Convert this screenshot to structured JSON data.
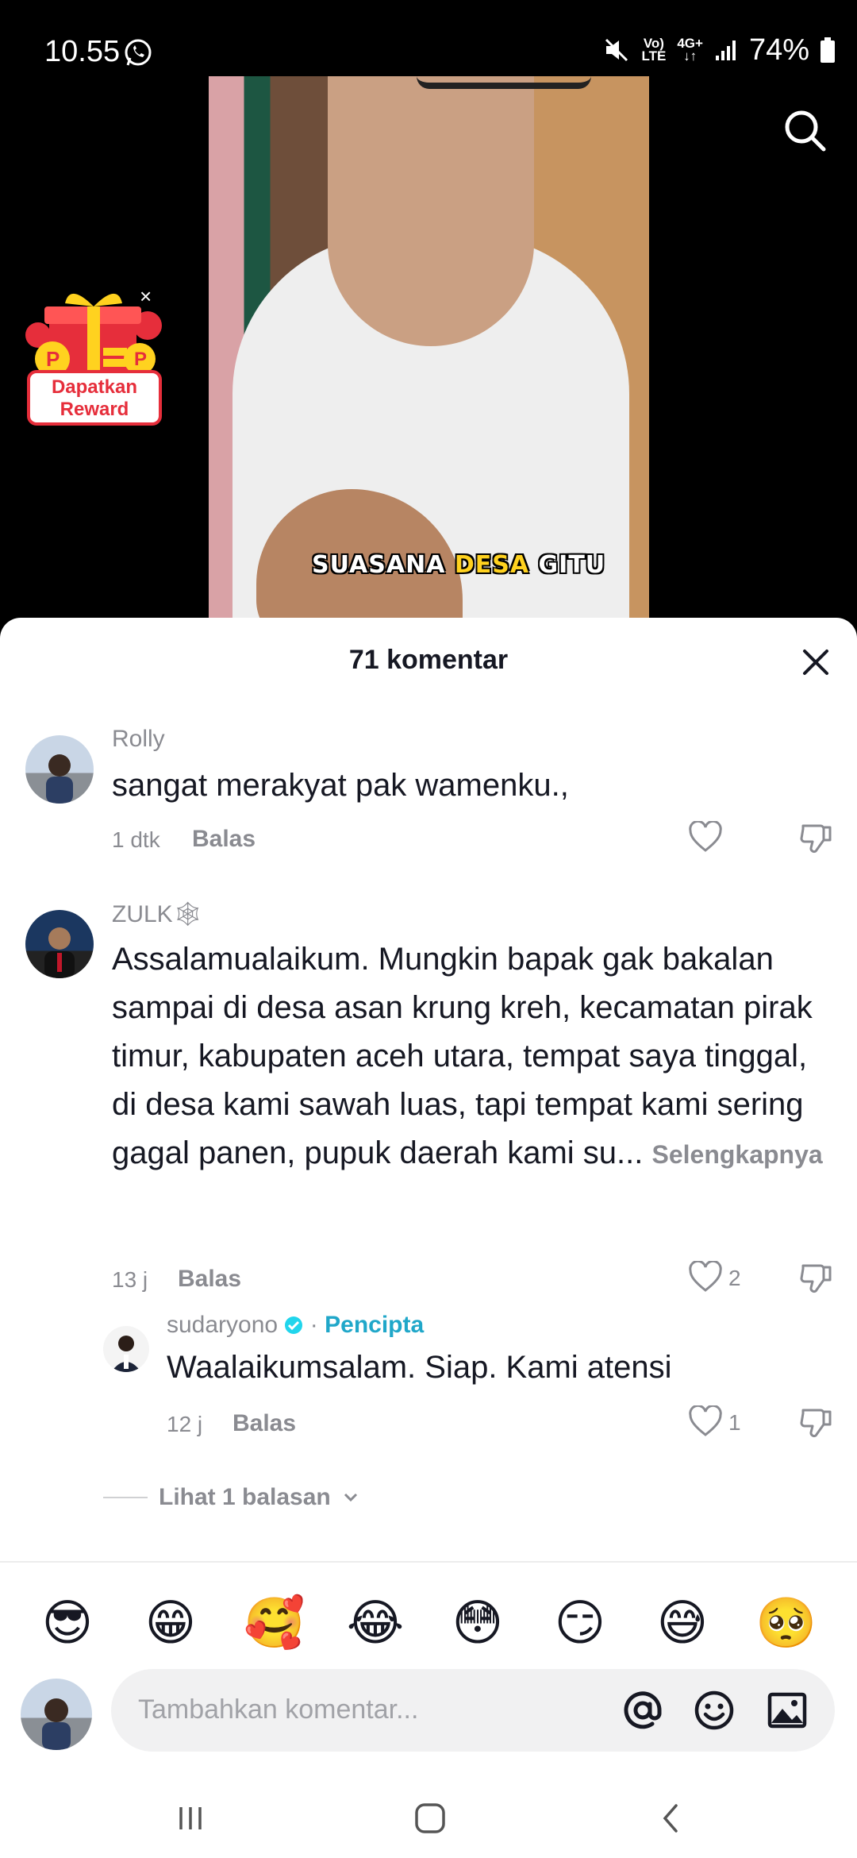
{
  "status_bar": {
    "time": "10.55",
    "network_top": "Vo)",
    "network_bottom": "LTE",
    "data_top": "4G+",
    "battery": "74%"
  },
  "video": {
    "caption_part1": "SUASANA ",
    "caption_highlight": "DESA",
    "caption_part2": " GITU"
  },
  "reward": {
    "label_line1": "Dapatkan",
    "label_line2": "Reward",
    "close": "×"
  },
  "comments_sheet": {
    "title": "71 komentar",
    "comments": [
      {
        "user": "Rolly",
        "text": "sangat merakyat pak wamenku.,",
        "time": "1 dtk",
        "reply_label": "Balas",
        "likes": ""
      },
      {
        "user": "ZULK🕸",
        "text": "Assalamualaikum. Mungkin bapak gak bakalan sampai di desa asan krung kreh, kecamatan pirak timur, kabupaten aceh utara, tempat saya tinggal, di desa kami sawah luas, tapi tempat kami sering gagal panen, pupuk daerah kami su...",
        "see_more": "Selengkapnya",
        "time": "13 j",
        "reply_label": "Balas",
        "likes": "2"
      }
    ],
    "reply": {
      "user": "sudaryono",
      "creator_tag": "Pencipta",
      "text": "Waalaikumsalam. Siap. Kami atensi",
      "time": "12 j",
      "reply_label": "Balas",
      "likes": "1"
    },
    "view_replies": "Lihat 1 balasan"
  },
  "emojis": [
    "😎",
    "😁",
    "🥰",
    "😂",
    "😳",
    "😏",
    "😅",
    "🥺"
  ],
  "input": {
    "placeholder": "Tambahkan komentar..."
  },
  "icons": {
    "whatsapp": "whatsapp-icon",
    "search": "search-icon",
    "close": "close-icon",
    "like": "heart-icon",
    "dislike": "thumbs-down-icon",
    "mention": "at-icon",
    "emoji": "smiley-icon",
    "image": "image-icon"
  },
  "colors": {
    "creator_accent": "#20a7c9",
    "reward_red": "#e62e3b",
    "caption_yellow": "#ffd21f"
  }
}
